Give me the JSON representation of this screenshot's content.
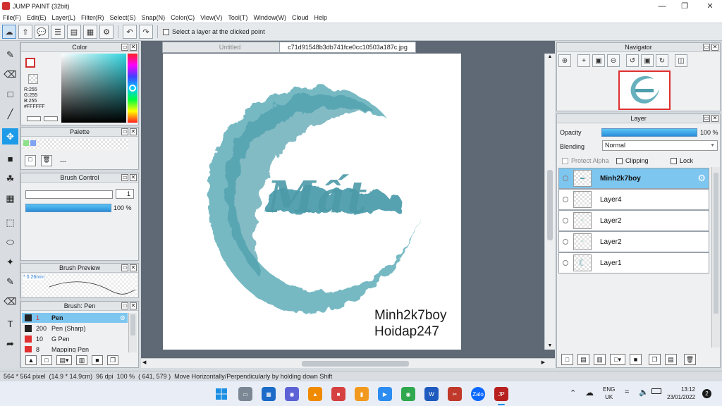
{
  "window": {
    "title": "JUMP PAINT (32bit)"
  },
  "menu": [
    "File(F)",
    "Edit(E)",
    "Layer(L)",
    "Filter(R)",
    "Select(S)",
    "Snap(N)",
    "Color(C)",
    "View(V)",
    "Tool(T)",
    "Window(W)",
    "Cloud",
    "Help"
  ],
  "toolbar": {
    "select_layer_label": "Select a layer at the clicked point"
  },
  "color_panel": {
    "title": "Color",
    "r": "R:255",
    "g": "G:255",
    "b": "B:255",
    "hex": "#FFFFFF"
  },
  "palette_panel": {
    "title": "Palette",
    "dash": "---"
  },
  "brush_control": {
    "title": "Brush Control",
    "size": "1",
    "opacity": "100 %"
  },
  "brush_preview": {
    "title": "Brush Preview",
    "size_label": "* 0.26mm"
  },
  "brush_list": {
    "title": "Brush: Pen",
    "items": [
      {
        "size": "1",
        "name": "Pen",
        "color": "#222222",
        "selected": true
      },
      {
        "size": "200",
        "name": "Pen (Sharp)",
        "color": "#222222",
        "selected": false
      },
      {
        "size": "10",
        "name": "G Pen",
        "color": "#e03030",
        "selected": false
      },
      {
        "size": "8",
        "name": "Mapping Pen",
        "color": "#e03030",
        "selected": false
      }
    ]
  },
  "tabs": {
    "untitled": "Untitled",
    "file": "c71d91548b3db741fce0cc10503a187c.jpg"
  },
  "artwork": {
    "word": "Mất",
    "caption_line1": "Minh2k7boy",
    "caption_line2": "Hoidap247"
  },
  "navigator": {
    "title": "Navigator"
  },
  "layer_panel": {
    "title": "Layer",
    "opacity_label": "Opacity",
    "opacity_value": "100 %",
    "blending_label": "Blending",
    "blending_value": "Normal",
    "protect_alpha": "Protect Alpha",
    "clipping": "Clipping",
    "lock": "Lock",
    "layers": [
      {
        "name": "Minh2k7boy",
        "selected": true
      },
      {
        "name": "Layer4",
        "selected": false
      },
      {
        "name": "Layer2",
        "selected": false
      },
      {
        "name": "Layer2",
        "selected": false
      },
      {
        "name": "Layer1",
        "selected": false
      }
    ]
  },
  "status": {
    "size": "564 * 564 pixel",
    "physical": "(14.9 * 14.9cm)",
    "dpi": "96 dpi",
    "zoom": "100 %",
    "coords": "( 641, 579 )",
    "hint": "Move Horizontally/Perpendicularly by holding down Shift"
  },
  "taskbar": {
    "lang1": "ENG",
    "lang2": "UK",
    "time": "13:12",
    "date": "23/01/2022",
    "notif": "2"
  },
  "colors": {
    "accent": "#1e9be8",
    "layer_selected": "#7dc6f0",
    "teal": "#5aa7b4"
  }
}
